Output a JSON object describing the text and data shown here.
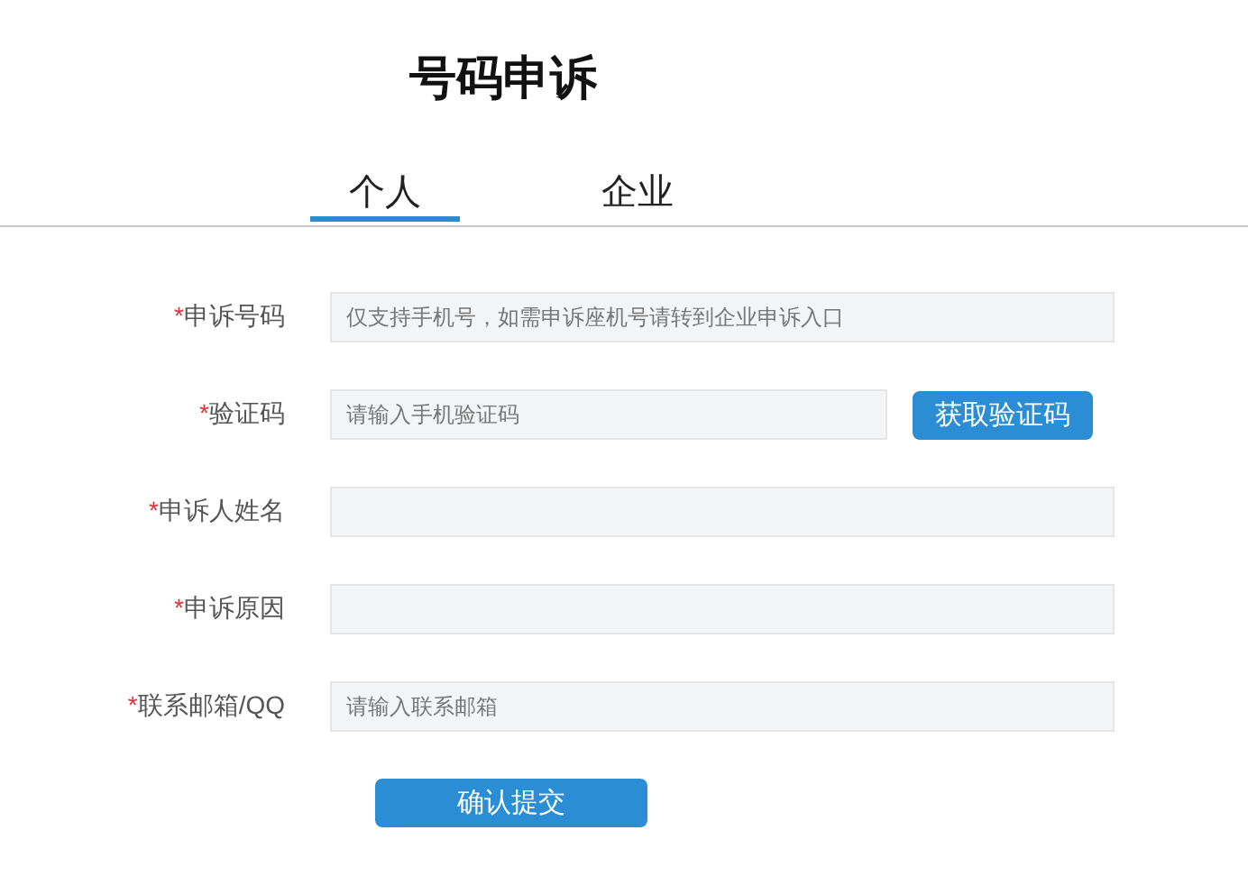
{
  "title": "号码申诉",
  "tabs": [
    {
      "label": "个人",
      "selected": true
    },
    {
      "label": "企业",
      "selected": false
    }
  ],
  "form": {
    "rows": [
      {
        "kind": "field",
        "mark": "*",
        "label": "申诉号码",
        "placeholder": "仅支持手机号，如需申诉座机号请转到企业申诉入口"
      },
      {
        "kind": "field_button",
        "mark": "*",
        "label": "验证码",
        "placeholder": "请输入手机验证码",
        "button": "获取验证码"
      },
      {
        "kind": "field",
        "mark": "*",
        "label": "申诉人姓名"
      },
      {
        "kind": "field",
        "mark": "*",
        "label": "申诉原因"
      },
      {
        "kind": "field",
        "mark": "*",
        "label": "联系邮箱/QQ",
        "placeholder": "请输入联系邮箱"
      }
    ],
    "submit": "确认提交"
  }
}
